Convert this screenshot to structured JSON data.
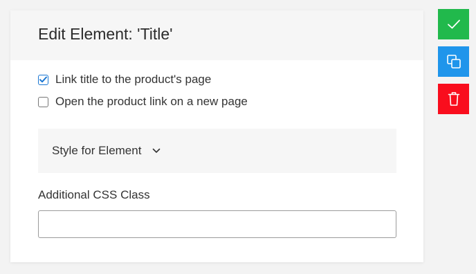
{
  "panel": {
    "title": "Edit Element: 'Title'"
  },
  "options": [
    {
      "label": "Link title to the product's page",
      "checked": true
    },
    {
      "label": "Open the product link on a new page",
      "checked": false
    }
  ],
  "style_section": {
    "label": "Style for Element",
    "icon": "chevron-down-icon"
  },
  "css_class": {
    "label": "Additional CSS Class",
    "value": ""
  },
  "actions": {
    "save": {
      "icon": "check-icon",
      "color": "#21b94c"
    },
    "duplicate": {
      "icon": "copy-icon",
      "color": "#1f95eb"
    },
    "delete": {
      "icon": "trash-icon",
      "color": "#f90d1d"
    }
  },
  "colors": {
    "accent": "#1976d2"
  }
}
